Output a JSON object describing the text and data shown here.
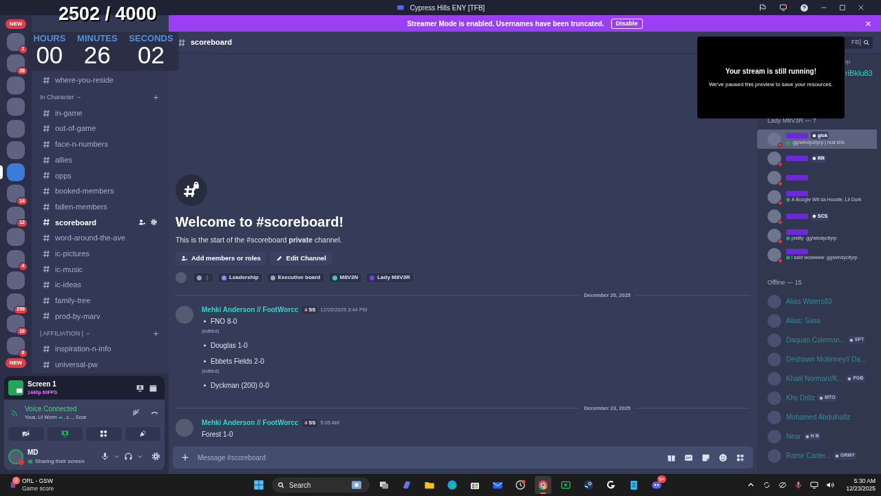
{
  "overlay": {
    "counter": "2502 / 4000",
    "timer": [
      {
        "label": "HOURS",
        "value": "00"
      },
      {
        "label": "MINUTES",
        "value": "26"
      },
      {
        "label": "SECONDS",
        "value": "02"
      }
    ]
  },
  "window": {
    "title": "Cypress Hills ENY [TFB]"
  },
  "banner": {
    "text": "Streamer Mode is enabled. Usernames have been truncated.",
    "button": "Disable"
  },
  "servers": [
    {
      "kind": "pill",
      "badge": "NEW"
    },
    {
      "kind": "icon",
      "badge": "1",
      "selected": false
    },
    {
      "kind": "icon",
      "badge": "28",
      "selected": false
    },
    {
      "kind": "icon",
      "selected": false
    },
    {
      "kind": "icon",
      "selected": false
    },
    {
      "kind": "icon",
      "selected": false
    },
    {
      "kind": "icon",
      "selected": false
    },
    {
      "kind": "icon",
      "selected": true
    },
    {
      "kind": "icon",
      "badge": "14",
      "selected": false
    },
    {
      "kind": "icon",
      "badge": "12",
      "selected": false
    },
    {
      "kind": "icon",
      "selected": false
    },
    {
      "kind": "icon",
      "badge": "4",
      "selected": false
    },
    {
      "kind": "icon",
      "selected": false
    },
    {
      "kind": "icon",
      "badge": "299",
      "selected": false
    },
    {
      "kind": "icon",
      "badge": "10",
      "selected": false
    },
    {
      "kind": "icon",
      "badge": "6",
      "selected": false
    },
    {
      "kind": "pill",
      "badge": "NEW"
    }
  ],
  "channels": {
    "top": [
      {
        "name": "where-you-reside",
        "selected": false
      }
    ],
    "categories": [
      {
        "name": "In Character",
        "channels": [
          {
            "name": "in-game",
            "selected": false
          },
          {
            "name": "out-of-game",
            "selected": false
          },
          {
            "name": "face-n-numbers",
            "selected": false
          },
          {
            "name": "allies",
            "selected": false
          },
          {
            "name": "opps",
            "selected": false
          },
          {
            "name": "booked-members",
            "selected": false
          },
          {
            "name": "fallen-members",
            "selected": false
          },
          {
            "name": "scoreboard",
            "selected": true
          },
          {
            "name": "word-around-the-ave",
            "selected": false
          },
          {
            "name": "ic-pictures",
            "selected": false
          },
          {
            "name": "ic-music",
            "selected": false
          },
          {
            "name": "ic-ideas",
            "selected": false
          },
          {
            "name": "family-tree",
            "selected": false
          },
          {
            "name": "prod-by-marv",
            "selected": false
          }
        ]
      },
      {
        "name": "| AFFILIATION |",
        "channels": [
          {
            "name": "inspiration-n-info",
            "selected": false
          },
          {
            "name": "universal-pw",
            "selected": false
          }
        ]
      }
    ]
  },
  "voice": {
    "screen_title": "Screen 1",
    "quality": "1440p 60FPS",
    "status": "Voice Connected",
    "users_before": "Yous, Lil Worm",
    "users_after": ", c..., Scoe"
  },
  "user": {
    "name": "MD",
    "status": "Sharing their screen"
  },
  "channel_header": {
    "name": "scoreboard",
    "search": "FB]"
  },
  "welcome": {
    "title": "Welcome to #scoreboard!",
    "subtitle": "This is the start of the #scoreboard **private** channel.",
    "buttons": [
      "Add members or roles",
      "Edit Channel"
    ],
    "roles": [
      {
        "kind": "icon",
        "color": "#9ca3af"
      },
      {
        "kind": "role",
        "name": "Leadership",
        "color": "#8b8ff5"
      },
      {
        "kind": "role",
        "name": "Executive board",
        "color": "#9ca3af"
      },
      {
        "kind": "role",
        "name": "M8V3N",
        "color": "#2dd4bf"
      },
      {
        "kind": "role",
        "name": "Lady M8V3R",
        "color": "#7c3aed"
      }
    ]
  },
  "messages": [
    {
      "date": "December 20, 2025",
      "author": "Mehki Anderson // FootWorcc",
      "badge": "SS",
      "time": "12/20/2025 3:44 PM",
      "kind": "list",
      "items": [
        {
          "text": "FNO 8-0",
          "note": "(edited)"
        },
        {
          "text": "Douglas 1-0"
        },
        {
          "text": "Ebbets Fields 2-0",
          "note": "(edited)"
        },
        {
          "text": "Dyckman (200) 0-0"
        }
      ]
    },
    {
      "date": "December 23, 2025",
      "author": "Mehki Anderson // FootWorcc",
      "badge": "SS",
      "time": "5:05 AM",
      "kind": "text",
      "text": "Forest 1-0"
    }
  ],
  "composer": {
    "placeholder": "Message #scoreboard"
  },
  "stream_popup": {
    "title": "Your stream is still running!",
    "text": "We've paused this preview to save your resources."
  },
  "members": [
    {
      "kind": "cut",
      "header": "rp",
      "members": [
        {
          "name": "riBklu83"
        }
      ]
    },
    {
      "kind": "online",
      "header": "Lady M8V3R — 7",
      "members": [
        {
          "selected": true,
          "tag": "glok",
          "status": ".gg/windycityrp | real shit."
        },
        {
          "selected": false,
          "tag": "RR"
        },
        {
          "selected": false
        },
        {
          "selected": false,
          "status": "A Boogie Wit da Hoodie, Lil Durk"
        },
        {
          "selected": false,
          "tag": "SCS"
        },
        {
          "selected": false,
          "status": "pretty .gg/windycityrp"
        },
        {
          "selected": false,
          "status": "i said wowwww .gg/windycityrp"
        }
      ]
    },
    {
      "kind": "offline",
      "header": "Offline — 15",
      "members": [
        {
          "name": "Alias Waters83"
        },
        {
          "name": "Alias: Sasa"
        },
        {
          "name": "Daquan Coleman...",
          "tag": "EFT"
        },
        {
          "name": "Deshawn Mckinney// Da..."
        },
        {
          "name": "Khalil Norman//K...",
          "tag": "PGB"
        },
        {
          "name": "Khy Drillz",
          "tag": "MTO"
        },
        {
          "name": "Mohamed Abdulhafiz"
        },
        {
          "name": "Near",
          "tag": "H B"
        },
        {
          "name": "Ramir Carter...",
          "tag": "GRMY"
        }
      ]
    }
  ],
  "taskbar": {
    "widget_badge": "1",
    "widget_title": "ORL - GSW",
    "widget_subtitle": "Game score",
    "search": "Search",
    "time": "5:30 AM",
    "date": "12/23/2025",
    "apps": [
      {
        "kind": "taskview",
        "selected": false
      },
      {
        "kind": "copilot",
        "selected": false
      },
      {
        "kind": "explorer",
        "selected": false
      },
      {
        "kind": "edge",
        "selected": false
      },
      {
        "kind": "store",
        "selected": false
      },
      {
        "kind": "mail",
        "selected": false
      },
      {
        "kind": "clock",
        "selected": false
      },
      {
        "kind": "chrome",
        "selected": true
      },
      {
        "kind": "xbox",
        "selected": false
      },
      {
        "kind": "steam",
        "selected": false
      },
      {
        "kind": "logitech",
        "selected": false
      },
      {
        "kind": "notepad",
        "selected": false
      },
      {
        "kind": "discord",
        "selected": false,
        "badge": "9+"
      }
    ]
  }
}
